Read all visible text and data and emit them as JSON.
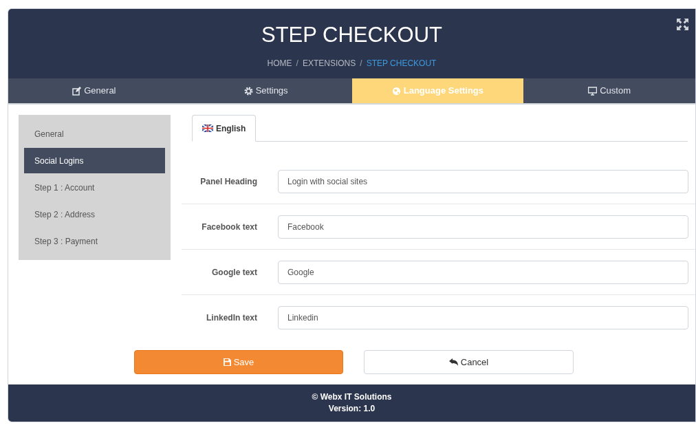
{
  "header": {
    "title": "STEP CHECKOUT",
    "breadcrumb": [
      {
        "label": "HOME",
        "selected": false
      },
      {
        "separator": "/",
        "label": "EXTENSIONS",
        "selected": false
      },
      {
        "separator": "/",
        "label": "STEP CHECKOUT",
        "selected": true
      }
    ]
  },
  "tabs": [
    {
      "label": "General",
      "kind": "edit",
      "selected": false
    },
    {
      "label": "Settings",
      "kind": "gear",
      "selected": false
    },
    {
      "label": "Language Settings",
      "kind": "language",
      "selected": true
    },
    {
      "label": "Custom",
      "kind": "monitor",
      "selected": false
    }
  ],
  "sidebar": {
    "items": [
      {
        "label": "General",
        "selected": false
      },
      {
        "label": "Social Logins",
        "selected": true
      },
      {
        "label": "Step 1 : Account",
        "selected": false
      },
      {
        "label": "Step 2 : Address",
        "selected": false
      },
      {
        "label": "Step 3 : Payment",
        "selected": false
      }
    ]
  },
  "language_tabs": [
    {
      "label": "English",
      "selected": true
    }
  ],
  "fields": [
    {
      "label": "Panel Heading",
      "value": "Login with social sites"
    },
    {
      "label": "Facebook text",
      "value": "Facebook"
    },
    {
      "label": "Google text",
      "value": "Google"
    },
    {
      "label": "LinkedIn text",
      "value": "Linkedin"
    }
  ],
  "buttons": {
    "save": "Save",
    "cancel": "Cancel"
  },
  "footer": {
    "copyright": "© Webx IT Solutions",
    "version": "Version: 1.0"
  }
}
